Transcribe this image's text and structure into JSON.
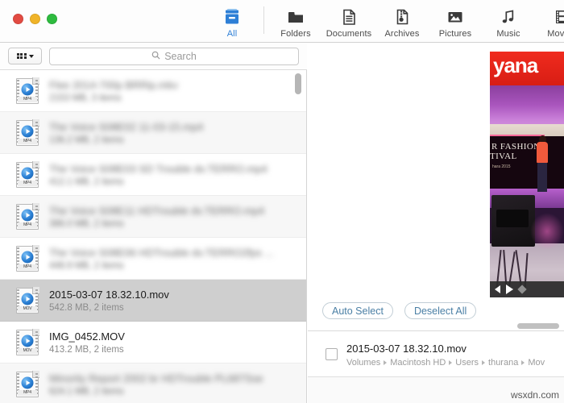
{
  "window": {
    "traffic_lights": [
      "close",
      "minimize",
      "zoom"
    ]
  },
  "toolbar": {
    "segments": [
      {
        "label": "All",
        "icon": "archive-box-icon",
        "active": true
      },
      {
        "label": "Folders",
        "icon": "folder-icon",
        "active": false
      },
      {
        "label": "Documents",
        "icon": "document-icon",
        "active": false
      },
      {
        "label": "Archives",
        "icon": "archive-file-icon",
        "active": false
      },
      {
        "label": "Pictures",
        "icon": "picture-icon",
        "active": false
      },
      {
        "label": "Music",
        "icon": "music-note-icon",
        "active": false
      },
      {
        "label": "Movies",
        "icon": "film-strip-icon",
        "active": false
      }
    ],
    "accent_color": "#2e7fd6"
  },
  "search": {
    "view_button_icon": "grid-view-icon",
    "view_chevron_icon": "chevron-down-icon",
    "search_icon": "search-icon",
    "placeholder": "Search",
    "value": ""
  },
  "file_list": {
    "rows": [
      {
        "name": "Flee 2014-700p BRRip.mkv",
        "meta": "2153 MB, 3 items",
        "ext": "MP4",
        "blurred": true,
        "selected": false
      },
      {
        "name": "The Voice S08E02 11-03-15.mp4",
        "meta": "136.2 MB, 2 items",
        "ext": "MP4",
        "blurred": true,
        "selected": false
      },
      {
        "name": "The Voice S08E03 SD Trouble dv.TERRO.mp4",
        "meta": "412.1 MB, 2 items",
        "ext": "MP4",
        "blurred": true,
        "selected": false
      },
      {
        "name": "The Voice S08E11 HDTrouble dv.TERRO.mp4",
        "meta": "386.0 MB, 2 items",
        "ext": "MP4",
        "blurred": true,
        "selected": false
      },
      {
        "name": "The Voice S08E06 HDTrouble dv.TERRO2fps ...",
        "meta": "448.9 MB, 2 items",
        "ext": "MP4",
        "blurred": true,
        "selected": false
      },
      {
        "name": "2015-03-07 18.32.10.mov",
        "meta": "542.8 MB, 2 items",
        "ext": "MOV",
        "blurred": false,
        "selected": true
      },
      {
        "name": "IMG_0452.MOV",
        "meta": "413.2 MB, 2 items",
        "ext": "MOV",
        "blurred": false,
        "selected": false
      },
      {
        "name": "Minority Report 2002 br HDTrouble PL687Sse",
        "meta": "624.1 MB, 2 items",
        "ext": "MP4",
        "blurred": true,
        "selected": false
      }
    ],
    "scrollbar": "vertical-scrollbar"
  },
  "preview": {
    "sign_text": "yana",
    "banner_line1": "R FASHION",
    "banner_line2": "TIVAL",
    "banner_year": "hara 2015",
    "controls": {
      "previous": "previous-frame-icon",
      "play": "play-icon",
      "marker": "marker-icon"
    }
  },
  "actions": {
    "auto_select": "Auto Select",
    "deselect_all": "Deselect All"
  },
  "detail": {
    "checkbox_checked": false,
    "file_name": "2015-03-07 18.32.10.mov",
    "breadcrumb": [
      "Volumes",
      "Macintosh HD",
      "Users",
      "thurana",
      "Mov"
    ]
  },
  "watermark": "wsxdn.com"
}
